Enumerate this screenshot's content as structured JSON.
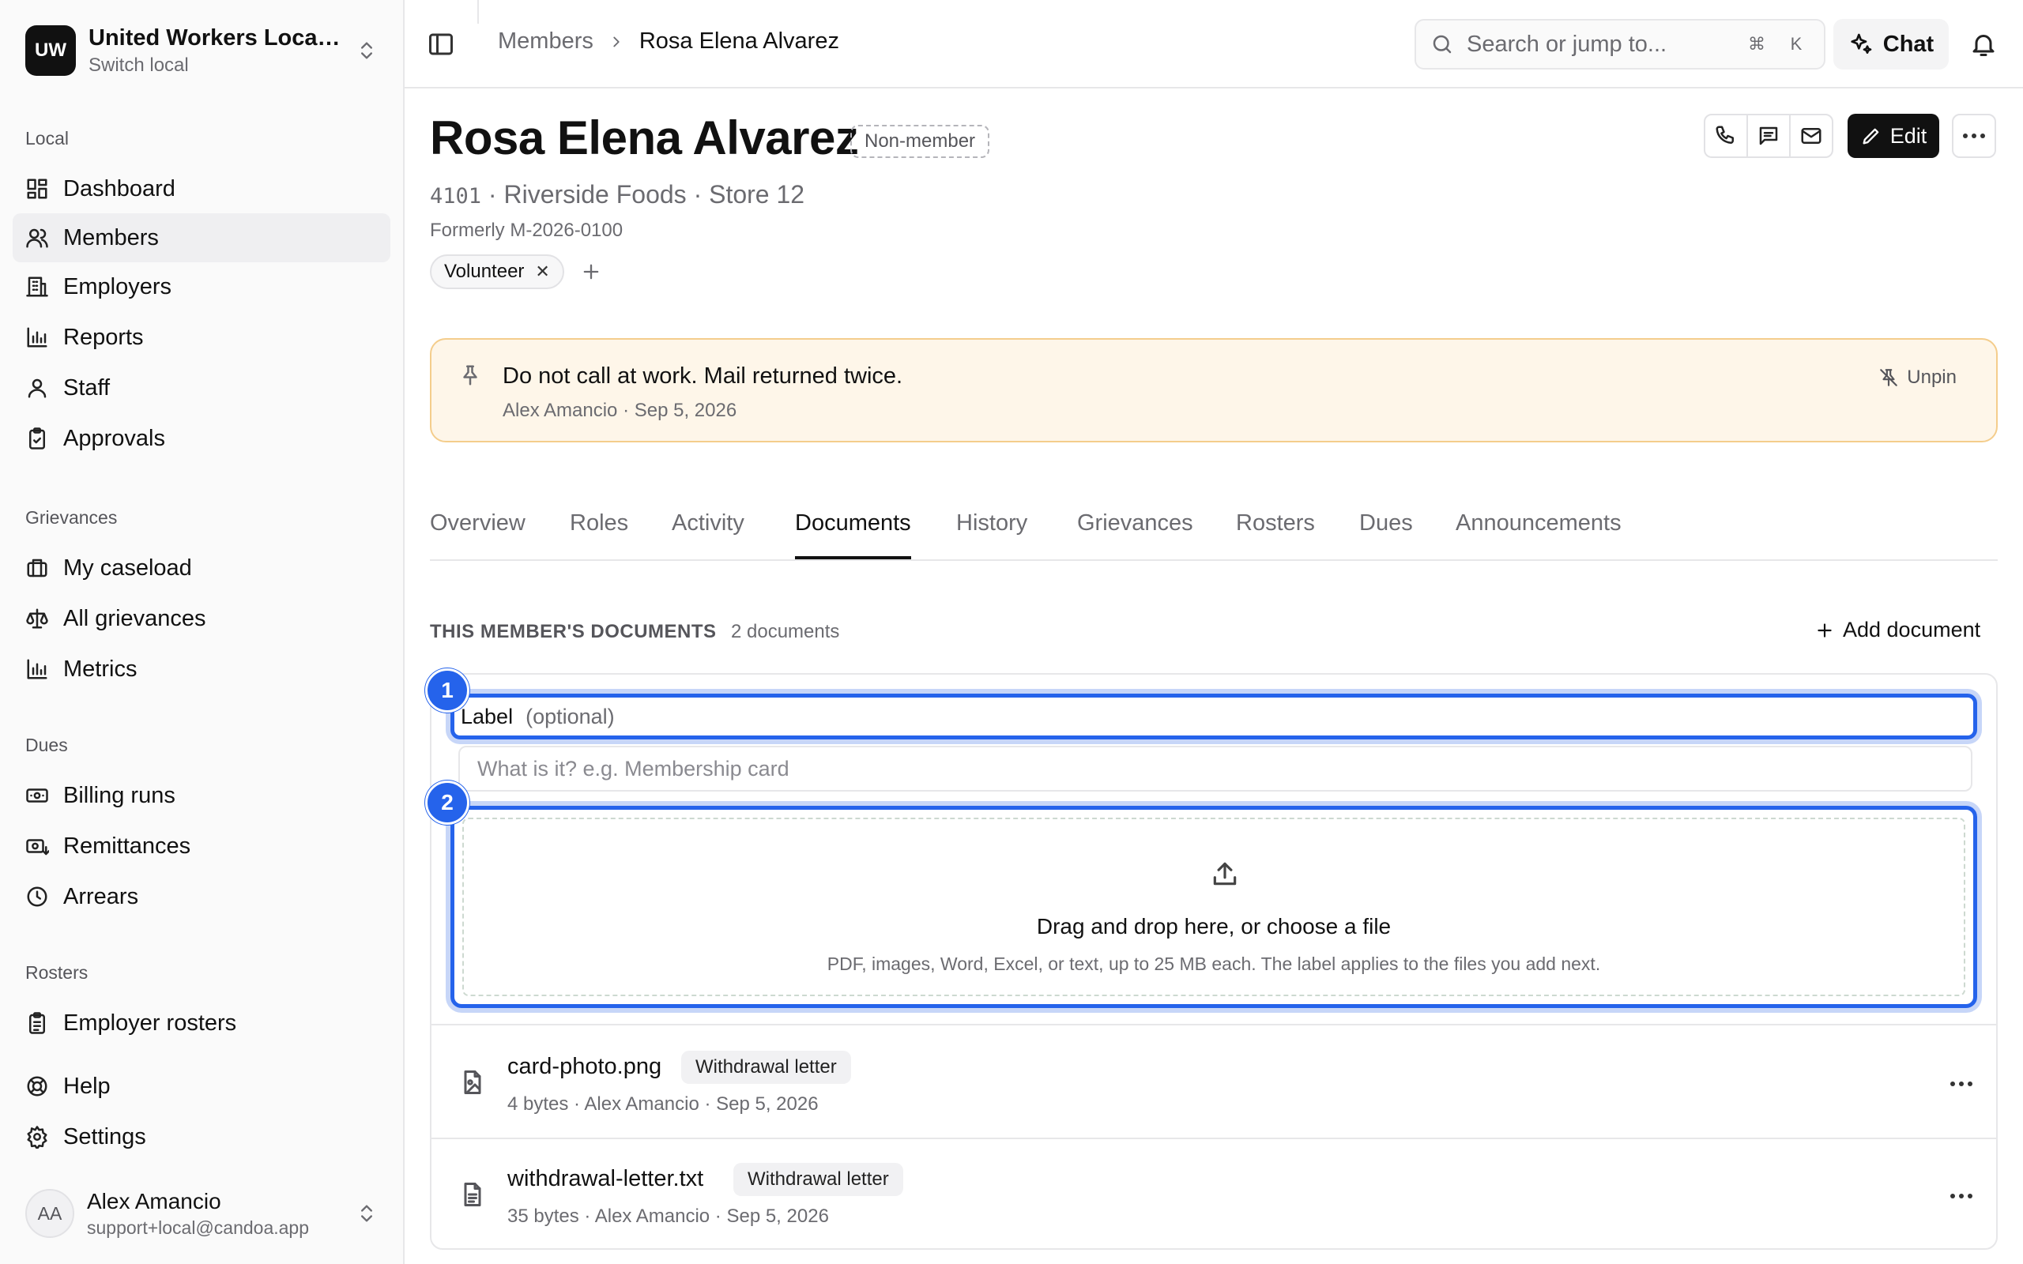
{
  "workspace": {
    "initials": "UW",
    "name": "United Workers Local ...",
    "sub": "Switch local"
  },
  "sidebar": {
    "sections": {
      "local": "Local",
      "grievances": "Grievances",
      "dues": "Dues",
      "rosters": "Rosters"
    },
    "items": {
      "dashboard": "Dashboard",
      "members": "Members",
      "employers": "Employers",
      "reports": "Reports",
      "staff": "Staff",
      "approvals": "Approvals",
      "my_caseload": "My caseload",
      "all_grievances": "All grievances",
      "metrics": "Metrics",
      "billing_runs": "Billing runs",
      "remittances": "Remittances",
      "arrears": "Arrears",
      "employer_rosters": "Employer rosters",
      "help": "Help",
      "settings": "Settings"
    },
    "user": {
      "initials": "AA",
      "name": "Alex Amancio",
      "email": "support+local@candoa.app"
    }
  },
  "topbar": {
    "breadcrumb": {
      "parent": "Members",
      "current": "Rosa Elena Alvarez"
    },
    "search_placeholder": "Search or jump to...",
    "kbd_cmd": "⌘",
    "kbd_key": "K",
    "chat_label": "Chat"
  },
  "member": {
    "name": "Rosa Elena Alvarez",
    "status_badge": "Non-member",
    "id": "4101",
    "employer_line": " · Riverside Foods · Store 12",
    "formerly": "Formerly M-2026-0100",
    "tag": "Volunteer",
    "edit_label": "Edit"
  },
  "note": {
    "text": "Do not call at work. Mail returned twice.",
    "meta": "Alex Amancio · Sep 5, 2026",
    "unpin_label": "Unpin"
  },
  "tabs": [
    "Overview",
    "Roles",
    "Activity",
    "Documents",
    "History",
    "Grievances",
    "Rosters",
    "Dues",
    "Announcements"
  ],
  "active_tab": "Documents",
  "documents": {
    "heading": "THIS MEMBER'S DOCUMENTS",
    "count": "2 documents",
    "add_label": "Add document",
    "label_field": {
      "label": "Label",
      "optional": "(optional)",
      "placeholder": "What is it? e.g. Membership card"
    },
    "dropzone": {
      "title": "Drag and drop here, or choose a file",
      "subtitle": "PDF, images, Word, Excel, or text, up to 25 MB each. The label applies to the files you add next."
    },
    "markers": [
      "1",
      "2"
    ],
    "files": [
      {
        "name": "card-photo.png",
        "tag": "Withdrawal letter",
        "meta": "4 bytes · Alex Amancio · Sep 5, 2026",
        "icon": "image-file-icon"
      },
      {
        "name": "withdrawal-letter.txt",
        "tag": "Withdrawal letter",
        "meta": "35 bytes · Alex Amancio · Sep 5, 2026",
        "icon": "text-file-icon"
      }
    ]
  },
  "colors": {
    "accent": "#2563eb",
    "note_bg": "#fef6e9",
    "note_border": "#f4cd8c"
  }
}
